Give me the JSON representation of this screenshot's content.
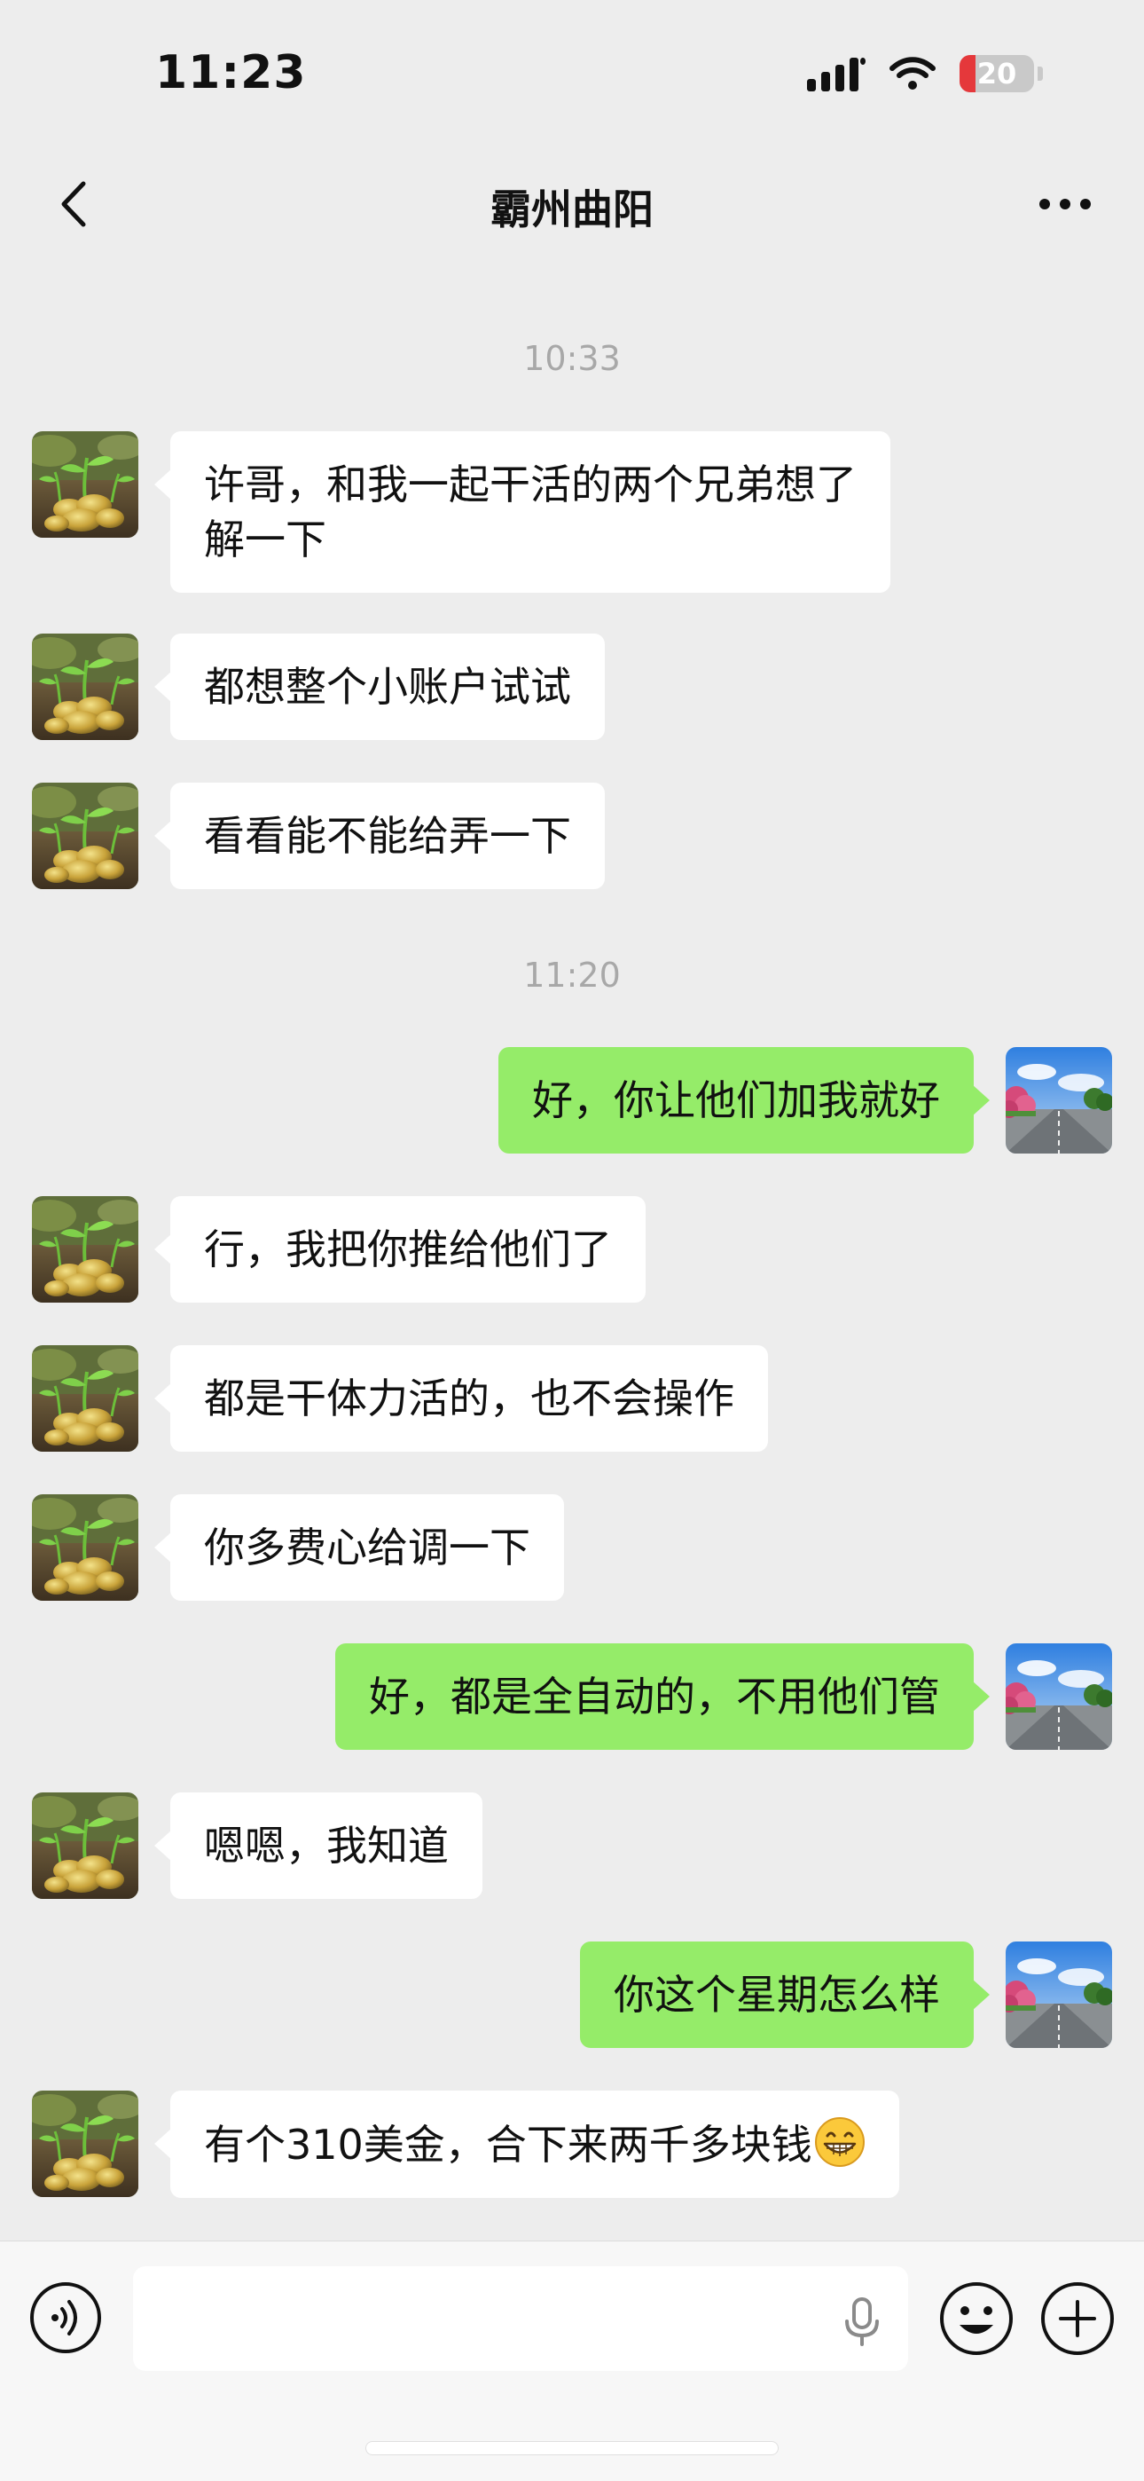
{
  "status_bar": {
    "time": "11:23",
    "battery": "20"
  },
  "header": {
    "title": "霸州曲阳"
  },
  "timestamps": [
    "10:33",
    "11:20"
  ],
  "messages": [
    {
      "side": "left",
      "text": "许哥，和我一起干活的两个兄弟想了\n解一下"
    },
    {
      "side": "left",
      "text": "都想整个小账户试试"
    },
    {
      "side": "left",
      "text": "看看能不能给弄一下"
    },
    {
      "side": "right",
      "text": "好，你让他们加我就好"
    },
    {
      "side": "left",
      "text": "行，我把你推给他们了"
    },
    {
      "side": "left",
      "text": "都是干体力活的，也不会操作"
    },
    {
      "side": "left",
      "text": "你多费心给调一下"
    },
    {
      "side": "right",
      "text": "好，都是全自动的，不用他们管"
    },
    {
      "side": "left",
      "text": "嗯嗯，我知道"
    },
    {
      "side": "right",
      "text": "你这个星期怎么样"
    },
    {
      "side": "left",
      "text": "有个310美金，合下来两千多块钱",
      "emoji": "grinning-face"
    }
  ],
  "input": {
    "value": "",
    "placeholder": ""
  },
  "colors": {
    "self_bubble": "#95ec69",
    "other_bubble": "#ffffff",
    "background": "#ededed"
  }
}
